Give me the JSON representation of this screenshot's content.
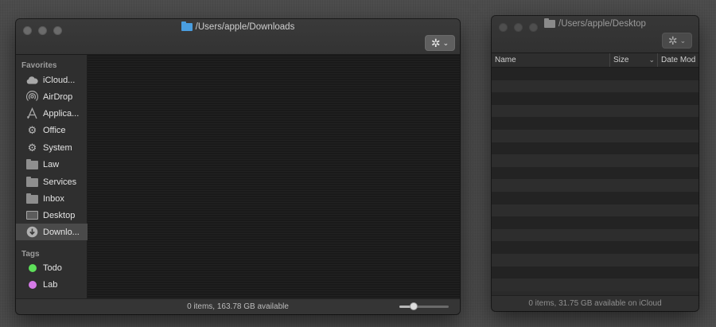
{
  "downloads_window": {
    "title": "/Users/apple/Downloads",
    "sidebar": {
      "favorites_heading": "Favorites",
      "favorites": [
        {
          "label": "iCloud...",
          "icon": "cloud-icon"
        },
        {
          "label": "AirDrop",
          "icon": "airdrop-icon"
        },
        {
          "label": "Applica...",
          "icon": "applications-icon"
        },
        {
          "label": "Office",
          "icon": "gear-icon"
        },
        {
          "label": "System",
          "icon": "gear-icon"
        },
        {
          "label": "Law",
          "icon": "folder-icon"
        },
        {
          "label": "Services",
          "icon": "folder-icon"
        },
        {
          "label": "Inbox",
          "icon": "folder-icon"
        },
        {
          "label": "Desktop",
          "icon": "desktop-icon"
        },
        {
          "label": "Downlo...",
          "icon": "downloads-icon",
          "selected": true
        }
      ],
      "tags_heading": "Tags",
      "tags": [
        {
          "label": "Todo",
          "color": "#5ee05a"
        },
        {
          "label": "Lab",
          "color": "#d57be8"
        }
      ]
    },
    "status": "0 items, 163.78 GB available",
    "zoom_level": 0.25,
    "title_folder_color": "#4a9ee0"
  },
  "desktop_window": {
    "title": "/Users/apple/Desktop",
    "columns": [
      "Name",
      "Size",
      "Date Mod"
    ],
    "status": "0 items, 31.75 GB available on iCloud",
    "title_folder_color": "#8a8a8a"
  }
}
